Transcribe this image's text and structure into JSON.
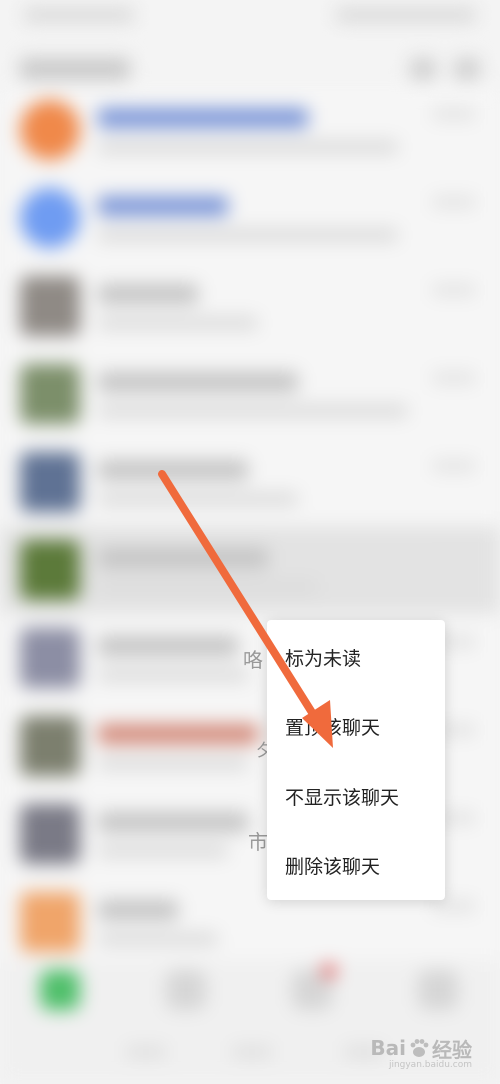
{
  "context_menu": {
    "items": [
      {
        "label": "标为未读"
      },
      {
        "label": "置顶该聊天"
      },
      {
        "label": "不显示该聊天"
      },
      {
        "label": "删除该聊天"
      }
    ]
  },
  "peek_text": {
    "row7": "咯",
    "row8": "夕",
    "row9": "市"
  },
  "watermark": {
    "brand": "Bai",
    "brand2": "经验",
    "sub": "jingyan.baidu.com"
  },
  "colors": {
    "annotation_arrow": "#f06a3c",
    "menu_bg": "#ffffff"
  }
}
